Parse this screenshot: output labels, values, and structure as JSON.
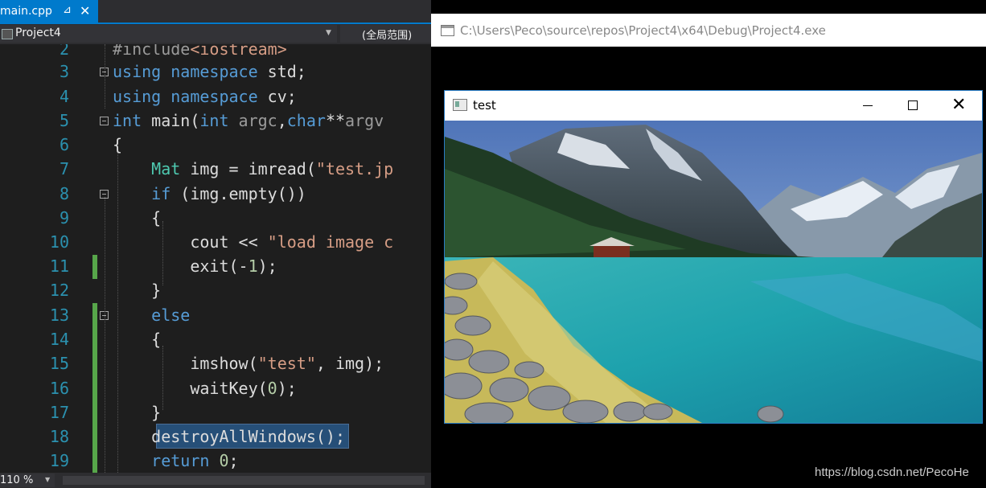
{
  "ide": {
    "tab_label": "main.cpp",
    "tab_pin": "⊿",
    "tab_close": "✕",
    "project_name": "Project4",
    "scope_label": "(全局范围)",
    "zoom_label": "110 %",
    "lines": [
      {
        "num": "2",
        "code": "#include<iostream>"
      },
      {
        "num": "3",
        "code": "using namespace std;"
      },
      {
        "num": "4",
        "code": "using namespace cv;"
      },
      {
        "num": "5",
        "code": "int main(int argc,char**argv"
      },
      {
        "num": "6",
        "code": "{"
      },
      {
        "num": "7",
        "code": "    Mat img = imread(\"test.jp"
      },
      {
        "num": "8",
        "code": "    if (img.empty())"
      },
      {
        "num": "9",
        "code": "    {"
      },
      {
        "num": "10",
        "code": "        cout << \"load image c"
      },
      {
        "num": "11",
        "code": "        exit(-1);"
      },
      {
        "num": "12",
        "code": "    }"
      },
      {
        "num": "13",
        "code": "    else"
      },
      {
        "num": "14",
        "code": "    {"
      },
      {
        "num": "15",
        "code": "        imshow(\"test\", img);"
      },
      {
        "num": "16",
        "code": "        waitKey(0);"
      },
      {
        "num": "17",
        "code": "    }"
      },
      {
        "num": "18",
        "code": "    destroyAllWindows();"
      },
      {
        "num": "19",
        "code": "    return 0;"
      }
    ]
  },
  "console": {
    "title": "C:\\Users\\Peco\\source\\repos\\Project4\\x64\\Debug\\Project4.exe"
  },
  "test_window": {
    "title": "test",
    "minimize_glyph": "—",
    "maximize_glyph": "☐",
    "close_glyph": "✕"
  },
  "watermark": "https://blog.csdn.net/PecoHe",
  "colors": {
    "vs_blue": "#007acc",
    "editor_bg": "#1e1e1e",
    "keyword": "#569cd6",
    "type": "#4ec9b0",
    "string": "#d69d85",
    "line_number": "#2b91af",
    "change_bar": "#57a64a"
  }
}
